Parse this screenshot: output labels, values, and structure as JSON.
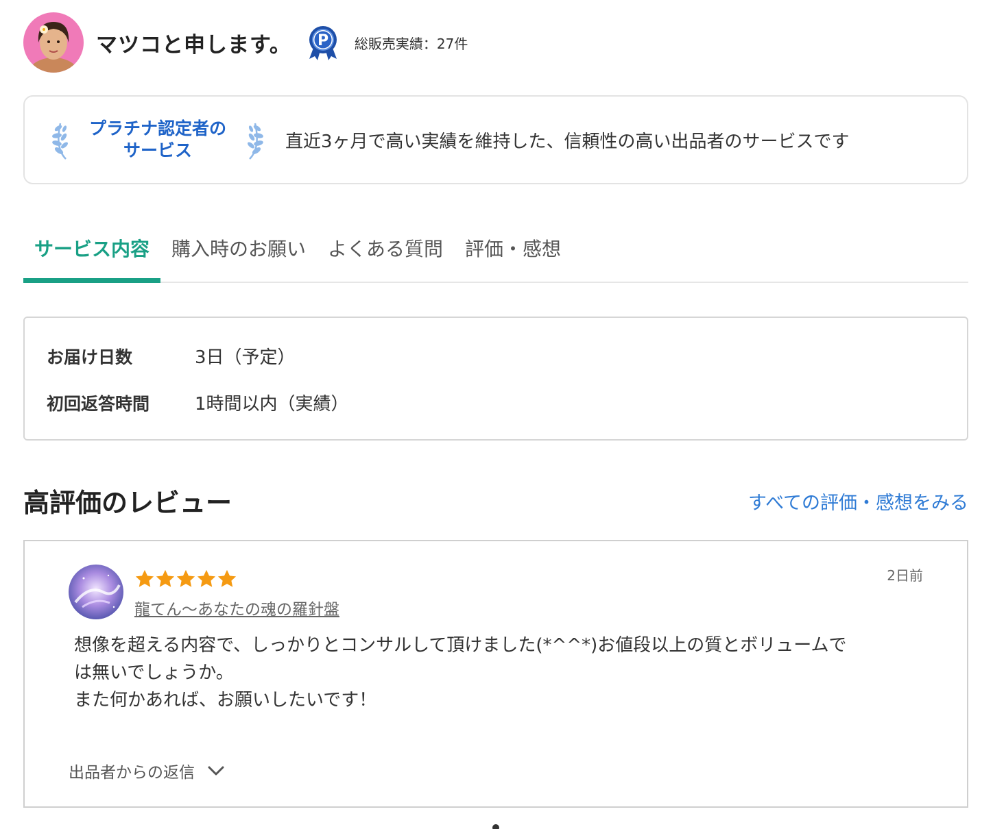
{
  "seller": {
    "name": "マツコと申します。",
    "sales_label": "総販売実績：27件",
    "badge_letter": "P"
  },
  "platinum": {
    "title_line1": "プラチナ認定者の",
    "title_line2": "サービス",
    "description": "直近3ヶ月で高い実績を維持した、信頼性の高い出品者のサービスです",
    "color": "#1e63c8"
  },
  "tabs": [
    {
      "label": "サービス内容",
      "active": true
    },
    {
      "label": "購入時のお願い",
      "active": false
    },
    {
      "label": "よくある質問",
      "active": false
    },
    {
      "label": "評価・感想",
      "active": false
    }
  ],
  "accent_color": "#19a085",
  "info": {
    "rows": [
      {
        "label": "お届け日数",
        "value": "3日（予定）"
      },
      {
        "label": "初回返答時間",
        "value": "1時間以内（実績）"
      }
    ]
  },
  "reviews": {
    "heading": "高評価のレビュー",
    "see_all": "すべての評価・感想をみる",
    "items": [
      {
        "rating": 5,
        "reviewer": "龍てん〜あなたの魂の羅針盤",
        "date": "2日前",
        "body_line1": "想像を超える内容で、しっかりとコンサルして頂けました(*^^*)お値段以上の質とボリュームで",
        "body_line2": "は無いでしょうか。",
        "body_line3": "また何かあれば、お願いしたいです！",
        "reply_label": "出品者からの返信"
      }
    ]
  },
  "star_color": "#f59a12"
}
